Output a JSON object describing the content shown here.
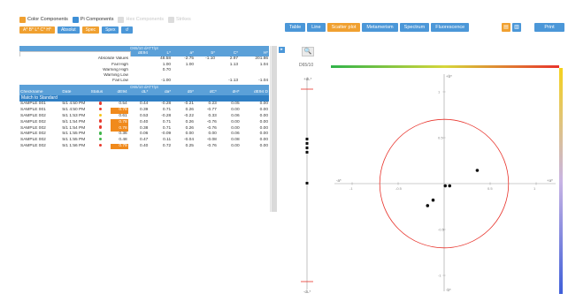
{
  "colors": {
    "accent_blue": "#4b97d8",
    "accent_orange": "#f0a030",
    "tolerance_red": "#e83a2d"
  },
  "toolbar_checks": [
    {
      "label": "Color Components",
      "checked": true,
      "style": "orange"
    },
    {
      "label": "Pi Components",
      "checked": true,
      "style": "blue"
    },
    {
      "label": "Hex Components",
      "checked": false,
      "style": "grey"
    },
    {
      "label": "Strikes",
      "checked": false,
      "style": "grey"
    }
  ],
  "mode_buttons": [
    "A* B* L* C* H*",
    "Absolut",
    "Spec",
    "Spex",
    "↺"
  ],
  "tabs": [
    "Table",
    "Line",
    "Scatter plot",
    "Metamerism",
    "Spectrum",
    "Fluorescence"
  ],
  "active_tab": 2,
  "view_buttons": [
    "▤",
    "▥"
  ],
  "print_label": "Print",
  "zoom_icon": "🔍",
  "illuminant_label": "D65/10",
  "left_panel": {
    "illuminant_band": "D65/10 dATT/pt",
    "illuminant_band_2": "D65/10 dATT/pt",
    "col_headers": [
      "dE94",
      "L*",
      "a*",
      "b*",
      "C*",
      "H*",
      "dE94 D"
    ],
    "summary_rows": [
      {
        "label": "Absolute Values",
        "values": [
          "48.58",
          "-2.75",
          "-1.10",
          "2.97",
          "201.86",
          "0.00"
        ]
      },
      {
        "label": "Fail High",
        "values": [
          "1.00",
          "1.00",
          "",
          "1.13",
          "1.04",
          "0.13"
        ]
      },
      {
        "label": "Warning High",
        "values": [
          "0.70",
          "",
          "",
          "",
          "",
          "0.22"
        ]
      },
      {
        "label": "Warning Low",
        "values": [
          "",
          "",
          "",
          "",
          "",
          ""
        ]
      },
      {
        "label": "Fail Low",
        "values": [
          "-1.00",
          "",
          "",
          "-1.13",
          "-1.04",
          ""
        ]
      }
    ],
    "table_headers": [
      "Checkname",
      "Date",
      "Status",
      "dE94",
      "dL*",
      "da*",
      "db*",
      "dC*",
      "dH*",
      "dE94 D"
    ],
    "match_label": "Match to Standard",
    "samples": [
      {
        "name": "SAMPLE 001",
        "date": "5/1 4:50 PM",
        "status": "red",
        "de": "0.54",
        "dl": "0.44",
        "da": "-0.28",
        "db": "-0.21",
        "dc": "0.23",
        "dh": "0.05",
        "ded": "0.00",
        "hl": false
      },
      {
        "name": "SAMPLE 001",
        "date": "5/1 4:50 PM",
        "status": "red",
        "de": "0.78",
        "dl": "0.39",
        "da": "0.71",
        "db": "0.26",
        "dc": "-0.77",
        "dh": "0.00",
        "ded": "0.00",
        "hl": true
      },
      {
        "name": "SAMPLE 002",
        "date": "5/1 1:53 PM",
        "status": "yellow",
        "de": "0.61",
        "dl": "0.53",
        "da": "-0.28",
        "db": "-0.22",
        "dc": "0.33",
        "dh": "0.06",
        "ded": "0.00",
        "hl": false
      },
      {
        "name": "SAMPLE 002",
        "date": "5/1 1:54 PM",
        "status": "red",
        "de": "0.78",
        "dl": "0.40",
        "da": "0.71",
        "db": "0.26",
        "dc": "-0.76",
        "dh": "0.00",
        "ded": "0.00",
        "hl": true
      },
      {
        "name": "SAMPLE 002",
        "date": "5/1 1:54 PM",
        "status": "red",
        "de": "0.78",
        "dl": "0.38",
        "da": "0.71",
        "db": "0.26",
        "dc": "-0.76",
        "dh": "0.00",
        "ded": "0.00",
        "hl": true
      },
      {
        "name": "SAMPLE 002",
        "date": "5/1 1:55 PM",
        "status": "green",
        "de": "0.36",
        "dl": "0.06",
        "da": "-0.09",
        "db": "0.00",
        "dc": "0.00",
        "dh": "0.06",
        "ded": "0.00",
        "hl": false
      },
      {
        "name": "SAMPLE 002",
        "date": "5/1 1:55 PM",
        "status": "green",
        "de": "0.48",
        "dl": "0.47",
        "da": "0.11",
        "db": "-0.04",
        "dc": "-0.08",
        "dh": "0.08",
        "ded": "0.00",
        "hl": false
      },
      {
        "name": "SAMPLE 002",
        "date": "5/1 1:56 PM",
        "status": "red",
        "de": "0.79",
        "dl": "0.40",
        "da": "0.72",
        "db": "0.25",
        "dc": "-0.76",
        "dh": "0.00",
        "ded": "0.00",
        "hl": true
      }
    ]
  },
  "plot": {
    "a_axis_label": "+a*",
    "a_neg_label": "-a*",
    "b_axis_label": "+b*",
    "b_neg_label": "-b*",
    "L_pos_label": "+dL*",
    "L_neg_label": "-dL*",
    "b_ticks": [
      "1",
      "0.5",
      "-0.5",
      "-1"
    ],
    "a_ticks": [
      "-1",
      "-0.5",
      "0.5",
      "1"
    ],
    "tolerance_radius": 0.5,
    "ab_points": [
      [
        -0.15,
        -0.2
      ],
      [
        -0.1,
        -0.15
      ],
      [
        0.01,
        -0.02
      ],
      [
        0.05,
        -0.02
      ],
      [
        0.3,
        0.12
      ]
    ],
    "L_points": [
      0.3,
      0.35,
      0.4,
      0.45,
      0.0
    ]
  }
}
